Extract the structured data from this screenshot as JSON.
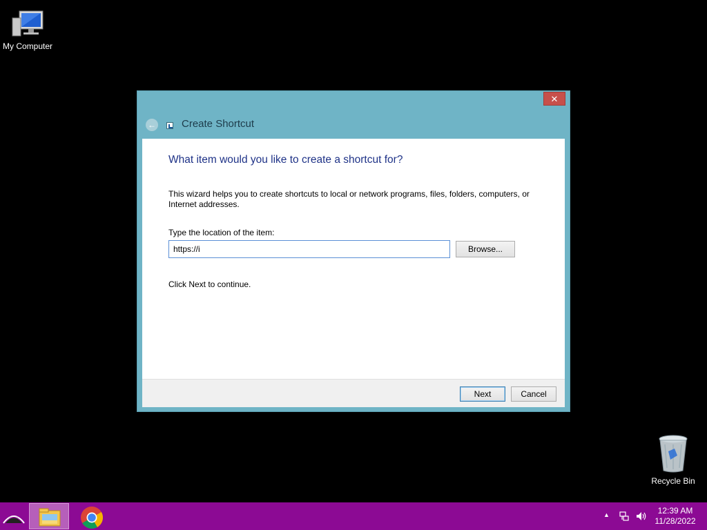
{
  "desktop": {
    "icons": [
      {
        "label": "My Computer",
        "icon": "computer-icon"
      },
      {
        "label": "Recycle Bin",
        "icon": "recycle-bin-icon"
      }
    ]
  },
  "dialog": {
    "title": "Create Shortcut",
    "close_label": "✕",
    "heading": "What item would you like to create a shortcut for?",
    "description": "This wizard helps you to create shortcuts to local or network programs, files, folders, computers, or Internet addresses.",
    "location_label": "Type the location of the item:",
    "location_value": "https://i",
    "browse_label": "Browse...",
    "continue_text": "Click Next to continue.",
    "next_label": "Next",
    "cancel_label": "Cancel",
    "colors": {
      "frame": "#6fb4c6",
      "heading": "#1e3287",
      "close": "#c7504b"
    }
  },
  "taskbar": {
    "color": "#8c0a94",
    "items": [
      {
        "icon": "start-icon"
      },
      {
        "icon": "file-explorer-icon"
      },
      {
        "icon": "chrome-icon"
      }
    ],
    "tray": {
      "time": "12:39 AM",
      "date": "11/28/2022"
    }
  }
}
